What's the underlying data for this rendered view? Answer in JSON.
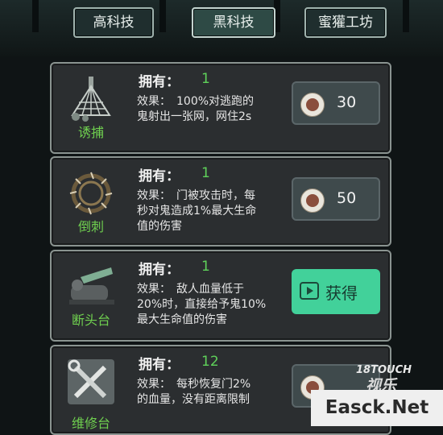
{
  "tabs": [
    {
      "label": "高科技",
      "active": false
    },
    {
      "label": "黑科技",
      "active": true
    },
    {
      "label": "蜜獾工坊",
      "active": false
    }
  ],
  "items": [
    {
      "name": "诱捕",
      "own_label": "拥有：",
      "count": "1",
      "desc": [
        "效果：　100%对逃跑的",
        "鬼射出一张网，网住2s"
      ],
      "action": {
        "type": "price",
        "value": "30"
      },
      "icon": "net-icon"
    },
    {
      "name": "倒刺",
      "own_label": "拥有：",
      "count": "1",
      "desc": [
        "效果：　门被攻击时，每",
        "秒对鬼造成1%最大生命",
        "值的伤害"
      ],
      "action": {
        "type": "price",
        "value": "50"
      },
      "icon": "thorns-icon"
    },
    {
      "name": "断头台",
      "own_label": "拥有：",
      "count": "1",
      "desc": [
        "效果：　敌人血量低于",
        "20%时，直接给予鬼10%",
        "最大生命值的伤害"
      ],
      "action": {
        "type": "get",
        "value": "获得"
      },
      "icon": "guillotine-icon"
    },
    {
      "name": "维修台",
      "own_label": "拥有：",
      "count": "12",
      "desc": [
        "效果：　每秒恢复门2%",
        "的血量，没有距离限制"
      ],
      "action": {
        "type": "price",
        "value": ""
      },
      "icon": "repair-tools-icon"
    }
  ],
  "watermark": {
    "logo_top": "18TOUCH",
    "logo_main": "视乐",
    "site": "Easck.Net"
  },
  "colors": {
    "accent_green": "#5fd25a",
    "get_button": "#42d19a"
  }
}
